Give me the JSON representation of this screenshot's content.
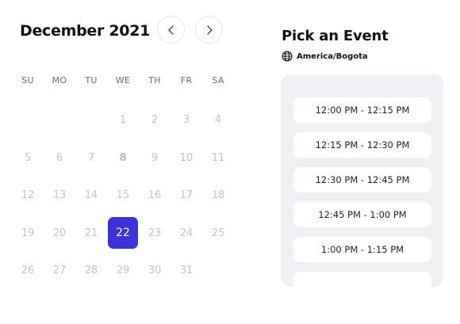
{
  "calendar": {
    "month_year": "December 2021",
    "weekdays": [
      "SU",
      "MO",
      "TU",
      "WE",
      "TH",
      "FR",
      "SA"
    ],
    "days": [
      "",
      "",
      "",
      "1",
      "2",
      "3",
      "4",
      "5",
      "6",
      "7",
      "8",
      "9",
      "10",
      "11",
      "12",
      "13",
      "14",
      "15",
      "16",
      "17",
      "18",
      "19",
      "20",
      "21",
      "22",
      "23",
      "24",
      "25",
      "26",
      "27",
      "28",
      "29",
      "30",
      "31",
      ""
    ],
    "selected_day": "22",
    "bold_day": "8"
  },
  "events": {
    "title": "Pick an Event",
    "timezone": "America/Bogota",
    "slots": [
      "12:00 PM - 12:15 PM",
      "12:15 PM - 12:30 PM",
      "12:30 PM - 12:45 PM",
      "12:45 PM - 1:00 PM",
      "1:00 PM - 1:15 PM",
      ""
    ]
  },
  "colors": {
    "accent": "#3b33d9",
    "panel_bg": "#eef0f3"
  }
}
